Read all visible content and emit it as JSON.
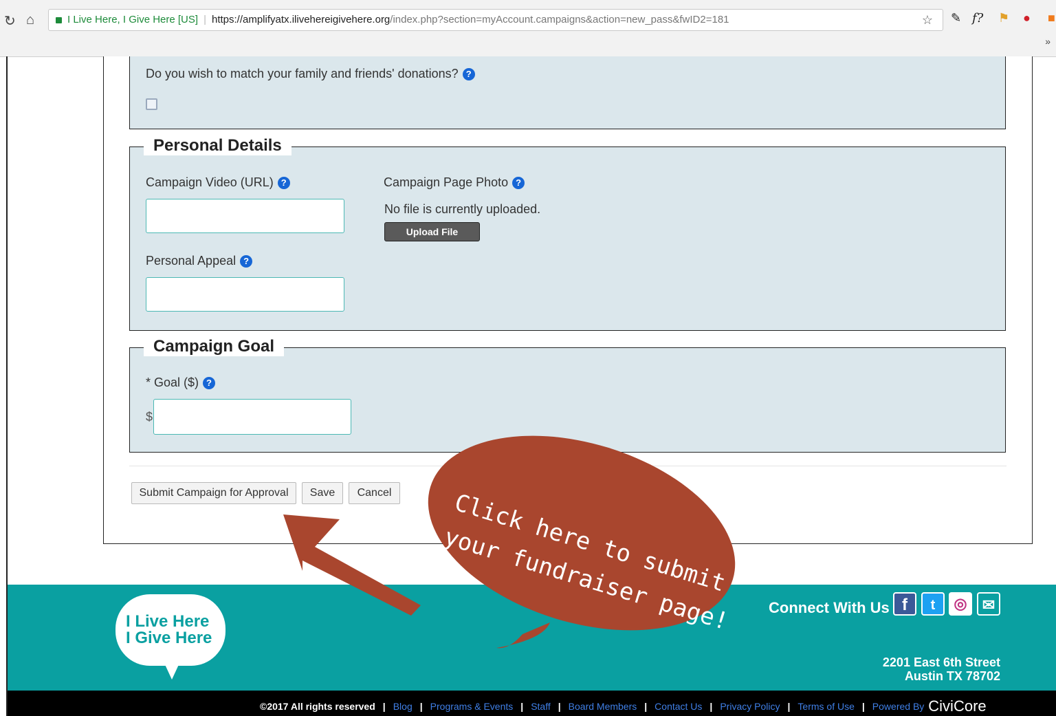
{
  "browser": {
    "site_name": "I Live Here, I Give Here [US]",
    "url_host": "https://amplifyatx.ilivehereigivehere.org",
    "url_path": "/index.php?section=myAccount.campaigns&action=new_pass&fwID2=181",
    "more_label": "»"
  },
  "form": {
    "match_question": "Do you wish to match your family and friends' donations?",
    "help_glyph": "?",
    "personal": {
      "legend": "Personal Details",
      "video_label": "Campaign Video (URL)",
      "appeal_label": "Personal Appeal",
      "photo_label": "Campaign Page Photo",
      "photo_status": "No file is currently uploaded.",
      "upload_button": "Upload File"
    },
    "goal": {
      "legend": "Campaign Goal",
      "goal_label": "* Goal ($)",
      "currency": "$"
    },
    "buttons": {
      "submit": "Submit Campaign for Approval",
      "save": "Save",
      "cancel": "Cancel"
    }
  },
  "annotation": {
    "line1": "Click here to submit",
    "line2": "your fundraiser page!",
    "color": "#a9462e"
  },
  "footer": {
    "logo_line1": "I Live Here",
    "logo_line2": "I Give Here",
    "connect": "Connect With Us",
    "social": [
      {
        "icon": "facebook-icon",
        "glyph": "f",
        "color": "#3b5998"
      },
      {
        "icon": "twitter-icon",
        "glyph": "t",
        "color": "#1da1f2"
      },
      {
        "icon": "instagram-icon",
        "glyph": "◎",
        "color": "#c13584"
      },
      {
        "icon": "email-icon",
        "glyph": "✉",
        "color": "#ffffff"
      }
    ],
    "address_line1": "2201 East 6th Street",
    "address_line2": "Austin TX 78702",
    "copyright": "©2017 All rights reserved",
    "links": [
      "Blog",
      "Programs & Events",
      "Staff",
      "Board Members",
      "Contact Us",
      "Privacy Policy",
      "Terms of Use",
      "Powered By"
    ],
    "powered_brand": "CiviCore",
    "teal": "#0aa0a1"
  }
}
